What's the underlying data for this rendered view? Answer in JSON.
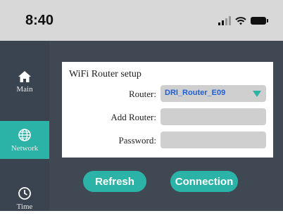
{
  "status_bar": {
    "time": "8:40"
  },
  "sidebar": {
    "items": [
      {
        "label": "Main",
        "icon": "home-icon"
      },
      {
        "label": "Network",
        "icon": "globe-icon"
      },
      {
        "label": "Time",
        "icon": "clock-icon"
      }
    ]
  },
  "panel": {
    "title": "WiFi Router setup",
    "router_label": "Router:",
    "router_value": "DRI_Router_E09",
    "add_router_label": "Add Router:",
    "add_router_value": "",
    "password_label": "Password:",
    "password_value": ""
  },
  "buttons": {
    "refresh": "Refresh",
    "connection": "Connection"
  },
  "colors": {
    "accent": "#2ab3a6",
    "sidebar": "#3a4350",
    "content_bg": "#3f4853",
    "status_bar": "#d8d8d8"
  }
}
